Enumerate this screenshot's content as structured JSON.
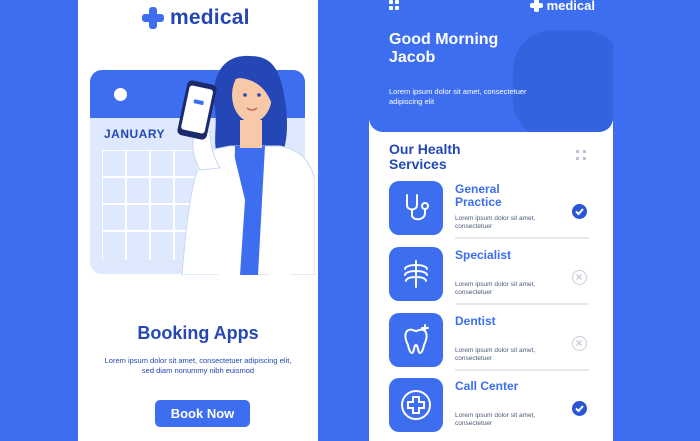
{
  "left_screen": {
    "brand": "medical",
    "calendar_month": "JANUARY",
    "title": "Booking Apps",
    "description": "Lorem ipsum dolor sit amet, consectetuer adipiscing elit, sed diam nonummy nibh euismod",
    "book_button": "Book Now"
  },
  "right_screen": {
    "brand": "medical",
    "greeting": "Good Morning Jacob",
    "greeting_sub": "Lorem ipsum dolor sit amet, consectetuer adipiscing elit",
    "services_title": "Our Health Services",
    "services": [
      {
        "name": "General Practice",
        "desc": "Lorem ipsum dolor sit amet, consectetuer",
        "icon": "stethoscope-icon",
        "selected": true
      },
      {
        "name": "Specialist",
        "desc": "Lorem ipsum dolor sit amet, consectetuer",
        "icon": "ribcage-icon",
        "selected": false
      },
      {
        "name": "Dentist",
        "desc": "Lorem ipsum dolor sit amet, consectetuer",
        "icon": "tooth-icon",
        "selected": false
      },
      {
        "name": "Call Center",
        "desc": "Lorem ipsum dolor sit amet, consectetuer",
        "icon": "medical-cross-icon",
        "selected": true
      }
    ]
  },
  "colors": {
    "accent": "#3d6ef0",
    "dark_blue": "#2447b5",
    "background": "#3d6ef0"
  }
}
